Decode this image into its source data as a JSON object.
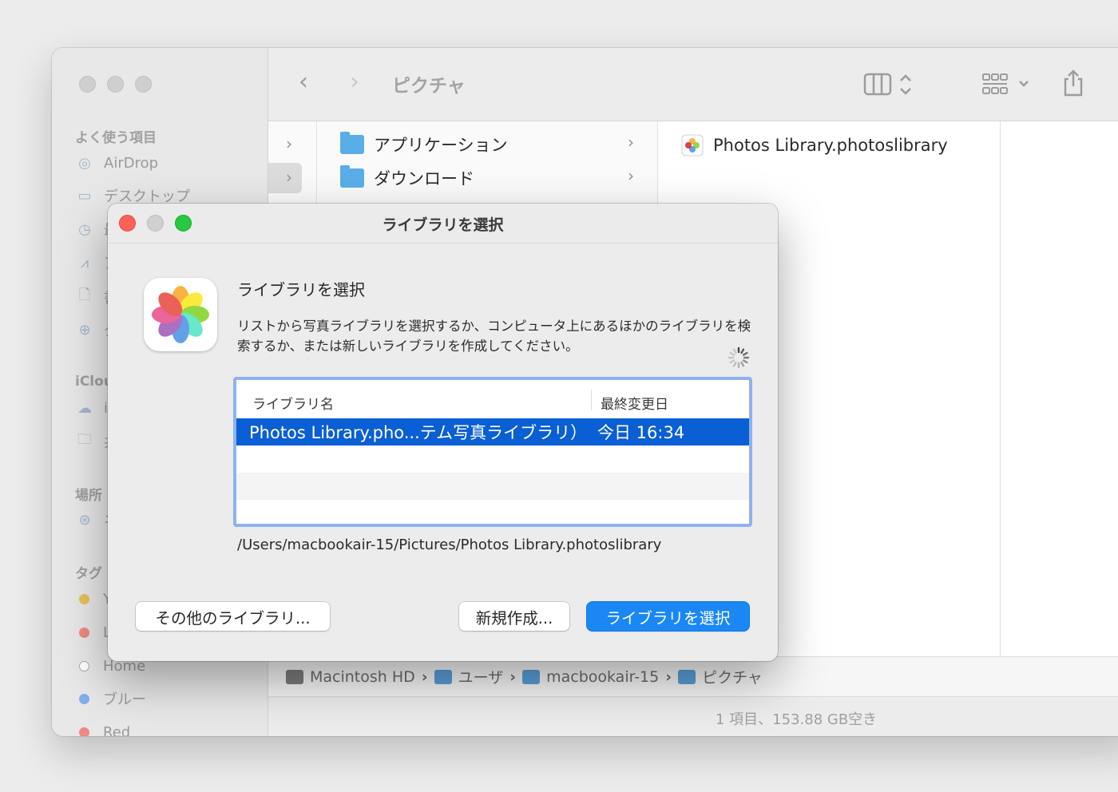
{
  "finder": {
    "title": "ピクチャ",
    "sidebar": {
      "favorites_header": "よく使う項目",
      "favorites": [
        {
          "label": "AirDrop",
          "icon": "airdrop-icon"
        },
        {
          "label": "デスクトップ",
          "icon": "desktop-icon"
        },
        {
          "label": "最",
          "icon": "clock-icon"
        },
        {
          "label": "ア",
          "icon": "applications-icon"
        },
        {
          "label": "書",
          "icon": "document-icon"
        },
        {
          "label": "ダ",
          "icon": "download-icon"
        }
      ],
      "icloud_header": "iClou",
      "icloud": [
        {
          "label": "i",
          "icon": "cloud-icon"
        },
        {
          "label": "共",
          "icon": "shared-folder-icon"
        }
      ],
      "locations_header": "場所",
      "locations": [
        {
          "label": "ネ",
          "icon": "network-icon"
        }
      ],
      "tags_header": "タグ",
      "tags": [
        {
          "label": "Y",
          "color": "#e8c25a"
        },
        {
          "label": "L",
          "color": "#ee6f6a"
        },
        {
          "label": "Home",
          "color": "#ffffff"
        },
        {
          "label": "ブルー",
          "color": "#4a90e8"
        },
        {
          "label": "Red",
          "color": "#ee6f6a"
        }
      ]
    },
    "column2": [
      {
        "label": "アプリケーション",
        "icon": "applications-folder-icon"
      },
      {
        "label": "ダウンロード",
        "icon": "downloads-folder-icon"
      }
    ],
    "column3": [
      {
        "label": "Photos Library.photoslibrary",
        "icon": "photos-library-icon"
      }
    ],
    "pathbar": [
      {
        "label": "Macintosh HD",
        "icon": "hard-drive-icon"
      },
      {
        "label": "ユーザ",
        "icon": "users-folder-icon"
      },
      {
        "label": "macbookair-15",
        "icon": "home-folder-icon"
      },
      {
        "label": "ピクチャ",
        "icon": "pictures-folder-icon"
      }
    ],
    "status": "1 項目、153.88 GB空き"
  },
  "dialog": {
    "title": "ライブラリを選択",
    "heading": "ライブラリを選択",
    "description": "リストから写真ライブラリを選択するか、コンピュータ上にあるほかのライブラリを検索するか、または新しいライブラリを作成してください。",
    "table": {
      "col_name": "ライブラリ名",
      "col_modified": "最終変更日",
      "rows": [
        {
          "name": "Photos Library.pho...テム写真ライブラリ）",
          "modified": "今日 16:34",
          "selected": true
        }
      ]
    },
    "path": "/Users/macbookair-15/Pictures/Photos Library.photoslibrary",
    "buttons": {
      "other": "その他のライブラリ...",
      "new": "新規作成...",
      "choose": "ライブラリを選択"
    }
  }
}
